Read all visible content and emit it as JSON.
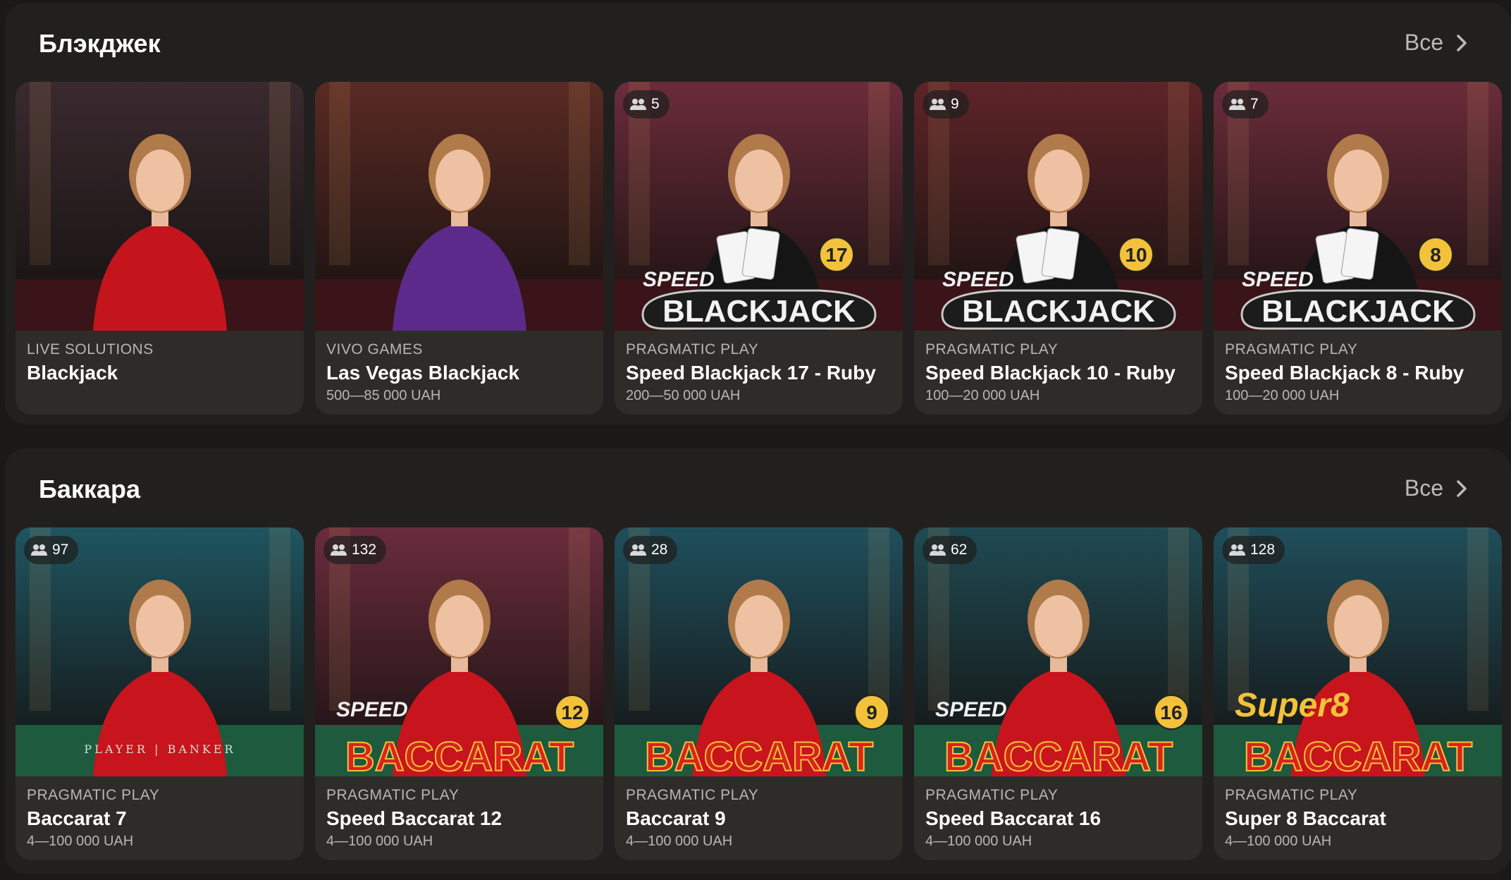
{
  "sections": [
    {
      "title": "Блэкджек",
      "all_label": "Все",
      "cards": [
        {
          "provider": "LIVE SOLUTIONS",
          "title": "Blackjack",
          "limits": "",
          "players": "",
          "bg": "#3a2a2f",
          "dress": "#c4141c",
          "logo": ""
        },
        {
          "provider": "VIVO GAMES",
          "title": "Las Vegas Blackjack",
          "limits": "500—85 000 UAH",
          "players": "",
          "bg": "#5a2a24",
          "dress": "#5b2a8a",
          "logo": ""
        },
        {
          "provider": "PRAGMATIC PLAY",
          "title": "Speed Blackjack 17 - Ruby",
          "limits": "200—50 000 UAH",
          "players": "5",
          "bg": "#6b2c3a",
          "dress": "#151515",
          "logo": "BLACKJACK",
          "logo_sub": "SPEED",
          "logo_num": "17"
        },
        {
          "provider": "PRAGMATIC PLAY",
          "title": "Speed Blackjack 10 - Ruby",
          "limits": "100—20 000 UAH",
          "players": "9",
          "bg": "#5e2428",
          "dress": "#151515",
          "logo": "BLACKJACK",
          "logo_sub": "SPEED",
          "logo_num": "10"
        },
        {
          "provider": "PRAGMATIC PLAY",
          "title": "Speed Blackjack 8 - Ruby",
          "limits": "100—20 000 UAH",
          "players": "7",
          "bg": "#6b2c3a",
          "dress": "#151515",
          "logo": "BLACKJACK",
          "logo_sub": "SPEED",
          "logo_num": "8"
        }
      ]
    },
    {
      "title": "Баккара",
      "all_label": "Все",
      "cards": [
        {
          "provider": "PRAGMATIC PLAY",
          "title": "Baccarat 7",
          "limits": "4—100 000 UAH",
          "players": "97",
          "bg": "#1f5560",
          "dress": "#c8141c",
          "logo": "",
          "table_text": "PLAYER | BANKER"
        },
        {
          "provider": "PRAGMATIC PLAY",
          "title": "Speed Baccarat 12",
          "limits": "4—100 000 UAH",
          "players": "132",
          "bg": "#6a2c3c",
          "dress": "#c8141c",
          "logo": "BACCARAT",
          "logo_sub": "SPEED",
          "logo_num": "12"
        },
        {
          "provider": "PRAGMATIC PLAY",
          "title": "Baccarat 9",
          "limits": "4—100 000 UAH",
          "players": "28",
          "bg": "#1f4f5c",
          "dress": "#c8141c",
          "logo": "BACCARAT",
          "logo_sub": "",
          "logo_num": "9"
        },
        {
          "provider": "PRAGMATIC PLAY",
          "title": "Speed Baccarat 16",
          "limits": "4—100 000 UAH",
          "players": "62",
          "bg": "#1f4a52",
          "dress": "#c8141c",
          "logo": "BACCARAT",
          "logo_sub": "SPEED",
          "logo_num": "16"
        },
        {
          "provider": "PRAGMATIC PLAY",
          "title": "Super 8 Baccarat",
          "limits": "4—100 000 UAH",
          "players": "128",
          "bg": "#1f4e5a",
          "dress": "#c8141c",
          "logo": "BACCARAT",
          "logo_sub": "Super8",
          "logo_num": ""
        }
      ]
    }
  ],
  "icons": {
    "players": "users-icon",
    "all_arrow": "chevron-right-icon"
  },
  "colors": {
    "page_bg": "#1a1917",
    "section_bg": "#22201e",
    "card_bg": "#2e2c29",
    "muted_text": "#b9b6b1"
  }
}
